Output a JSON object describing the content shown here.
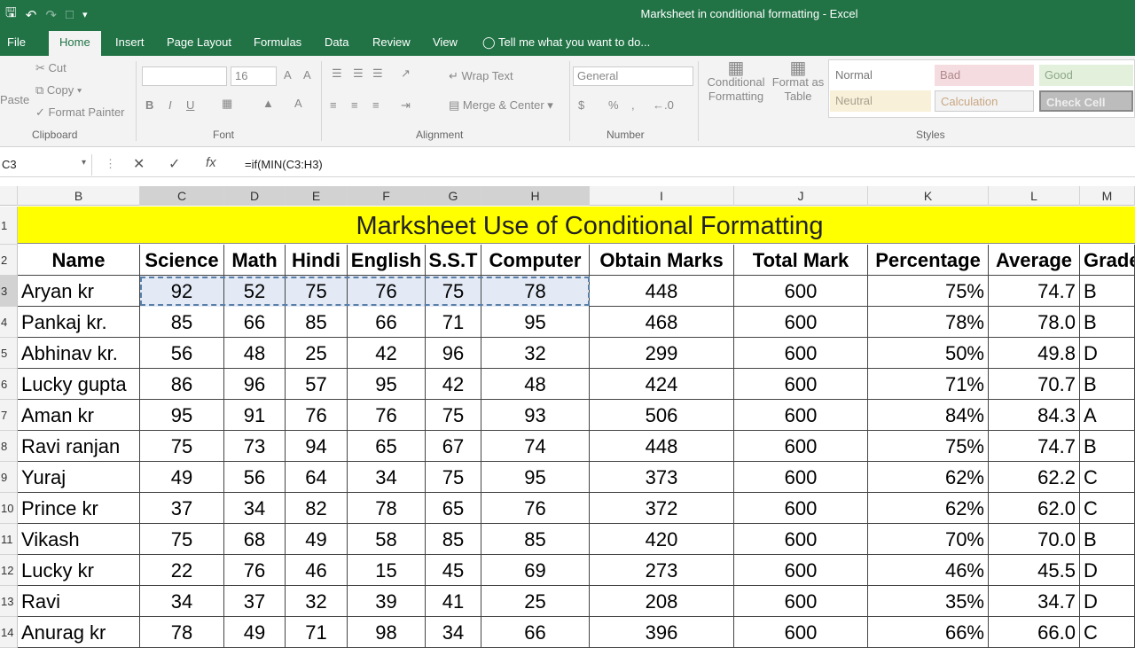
{
  "window": {
    "title": "Marksheet in conditional formatting - Excel"
  },
  "tabs": [
    "File",
    "Home",
    "Insert",
    "Page Layout",
    "Formulas",
    "Data",
    "Review",
    "View"
  ],
  "tell_me": "Tell me what you want to do...",
  "ribbon": {
    "clipboard": {
      "cut": "Cut",
      "copy": "Copy",
      "paste": "Paste",
      "format_painter": "Format Painter",
      "label": "Clipboard"
    },
    "font": {
      "size": "16",
      "label": "Font"
    },
    "alignment": {
      "wrap": "Wrap Text",
      "merge": "Merge & Center",
      "label": "Alignment"
    },
    "number": {
      "format": "General",
      "label": "Number"
    },
    "conditional": {
      "line1": "Conditional",
      "line2": "Formatting"
    },
    "format_table": {
      "line1": "Format as",
      "line2": "Table"
    },
    "styles": {
      "normal": "Normal",
      "bad": "Bad",
      "good": "Good",
      "neutral": "Neutral",
      "calculation": "Calculation",
      "check": "Check Cell",
      "label": "Styles"
    }
  },
  "formula_bar": {
    "name_box": "C3",
    "formula": "=if(MIN(C3:H3)"
  },
  "columns": [
    "B",
    "C",
    "D",
    "E",
    "F",
    "G",
    "H",
    "I",
    "J",
    "K",
    "L",
    "M"
  ],
  "sheet": {
    "title": "Marksheet Use of  Conditional Formatting",
    "headers": [
      "Name",
      "Science",
      "Math",
      "Hindi",
      "English",
      "S.S.T",
      "Computer",
      "Obtain Marks",
      "Total Mark",
      "Percentage",
      "Average",
      "Grade"
    ],
    "rows": [
      [
        "Aryan kr",
        "92",
        "52",
        "75",
        "76",
        "75",
        "78",
        "448",
        "600",
        "75%",
        "74.7",
        "B"
      ],
      [
        "Pankaj kr.",
        "85",
        "66",
        "85",
        "66",
        "71",
        "95",
        "468",
        "600",
        "78%",
        "78.0",
        "B"
      ],
      [
        "Abhinav kr.",
        "56",
        "48",
        "25",
        "42",
        "96",
        "32",
        "299",
        "600",
        "50%",
        "49.8",
        "D"
      ],
      [
        "Lucky gupta",
        "86",
        "96",
        "57",
        "95",
        "42",
        "48",
        "424",
        "600",
        "71%",
        "70.7",
        "B"
      ],
      [
        "Aman kr",
        "95",
        "91",
        "76",
        "76",
        "75",
        "93",
        "506",
        "600",
        "84%",
        "84.3",
        "A"
      ],
      [
        "Ravi ranjan",
        "75",
        "73",
        "94",
        "65",
        "67",
        "74",
        "448",
        "600",
        "75%",
        "74.7",
        "B"
      ],
      [
        "Yuraj",
        "49",
        "56",
        "64",
        "34",
        "75",
        "95",
        "373",
        "600",
        "62%",
        "62.2",
        "C"
      ],
      [
        "Prince kr",
        "37",
        "34",
        "82",
        "78",
        "65",
        "76",
        "372",
        "600",
        "62%",
        "62.0",
        "C"
      ],
      [
        "Vikash",
        "75",
        "68",
        "49",
        "58",
        "85",
        "85",
        "420",
        "600",
        "70%",
        "70.0",
        "B"
      ],
      [
        "Lucky kr",
        "22",
        "76",
        "46",
        "15",
        "45",
        "69",
        "273",
        "600",
        "46%",
        "45.5",
        "D"
      ],
      [
        "Ravi",
        "34",
        "37",
        "32",
        "39",
        "41",
        "25",
        "208",
        "600",
        "35%",
        "34.7",
        "D"
      ],
      [
        "Anurag kr",
        "78",
        "49",
        "71",
        "98",
        "34",
        "66",
        "396",
        "600",
        "66%",
        "66.0",
        "C"
      ]
    ],
    "row_numbers": [
      "1",
      "2",
      "3",
      "4",
      "5",
      "6",
      "7",
      "8",
      "9",
      "10",
      "11",
      "12",
      "13",
      "14"
    ]
  }
}
